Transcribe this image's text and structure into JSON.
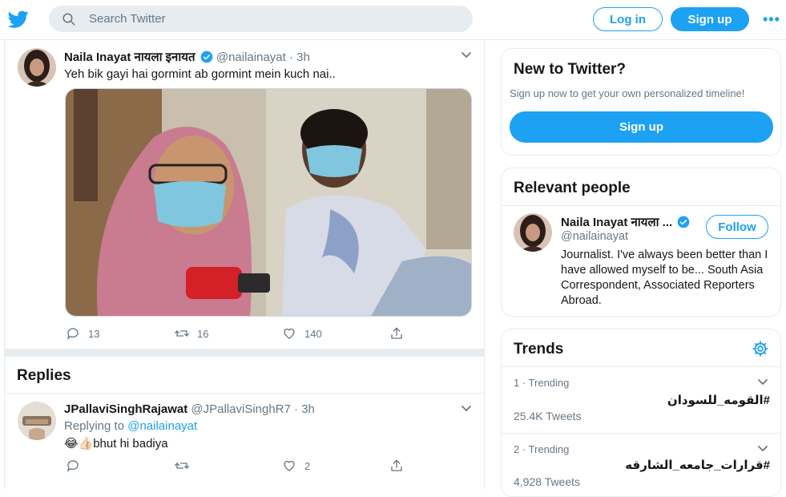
{
  "colors": {
    "accent": "#1da1f2",
    "muted": "#657786",
    "border": "#e6ecf0",
    "text": "#14171a"
  },
  "header": {
    "logo": "twitter-bird-icon",
    "search_placeholder": "Search Twitter",
    "login_label": "Log in",
    "signup_label": "Sign up",
    "more_label": "•••"
  },
  "tweet": {
    "name": "Naila Inayat नायला इनायत",
    "handle": "@nailainayat",
    "time": "· 3h",
    "text": "Yeh bik gayi hai gormint ab gormint mein kuch nai..",
    "replies": "13",
    "retweets": "16",
    "likes": "140"
  },
  "replies_section": {
    "title": "Replies",
    "items": [
      {
        "name": "JPallaviSinghRajawat",
        "handle": "@JPallaviSinghR7",
        "time": "· 3h",
        "replying_prefix": "Replying to ",
        "replying_to": "@nailainayat",
        "text": "😂👍🏻bhut hi badiya",
        "replies": "",
        "retweets": "",
        "likes": "2"
      }
    ]
  },
  "new_to_twitter": {
    "title": "New to Twitter?",
    "subtitle": "Sign up now to get your own personalized timeline!",
    "button": "Sign up"
  },
  "relevant_people": {
    "title": "Relevant people",
    "name": "Naila Inayat नायला ...",
    "handle": "@nailainayat",
    "follow_label": "Follow",
    "bio": "Journalist. I've always been better than I have allowed myself to be... South Asia Correspondent, Associated Reporters Abroad."
  },
  "trends": {
    "title": "Trends",
    "items": [
      {
        "meta": "1 · Trending",
        "name": "#القومه_للسودان",
        "count": "25.4K Tweets"
      },
      {
        "meta": "2 · Trending",
        "name": "#قرارات_جامعه_الشارقه",
        "count": "4,928 Tweets"
      }
    ]
  }
}
